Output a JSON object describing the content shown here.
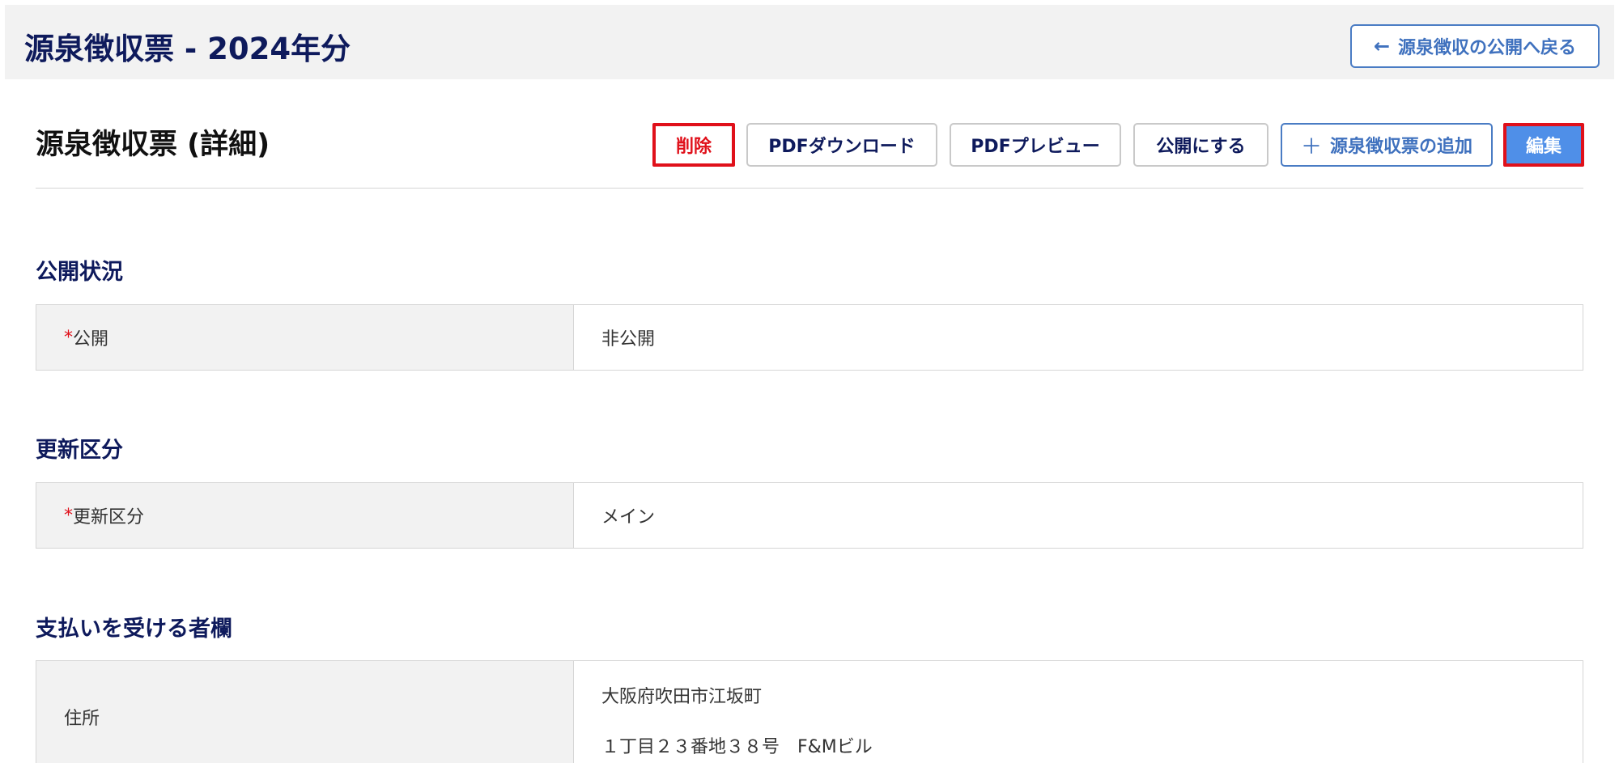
{
  "header": {
    "title": "源泉徴収票 - 2024年分",
    "back_label": "源泉徴収の公開へ戻る"
  },
  "detail": {
    "title": "源泉徴収票 (詳細)"
  },
  "toolbar": {
    "delete_label": "削除",
    "pdf_download_label": "PDFダウンロード",
    "pdf_preview_label": "PDFプレビュー",
    "publish_label": "公開にする",
    "add_label": "源泉徴収票の追加",
    "edit_label": "編集"
  },
  "sections": {
    "publish": {
      "heading": "公開状況",
      "required_mark": "*",
      "label": "公開",
      "value": "非公開"
    },
    "update": {
      "heading": "更新区分",
      "required_mark": "*",
      "label": "更新区分",
      "value": "メイン"
    },
    "recipient": {
      "heading": "支払いを受ける者欄",
      "address_label": "住所",
      "address_line1": "大阪府吹田市江坂町",
      "address_line2": "１丁目２３番地３８号　F&Mビル"
    }
  },
  "colors": {
    "title_navy": "#0e1a5c",
    "accent_blue": "#4f8fe8",
    "link_blue": "#3f71be",
    "danger_red": "#e0101a",
    "label_bg": "#f2f2f2",
    "border_gray": "#d6d6d6"
  },
  "icons": {
    "back": "arrow-left-icon",
    "add": "plus-icon"
  }
}
